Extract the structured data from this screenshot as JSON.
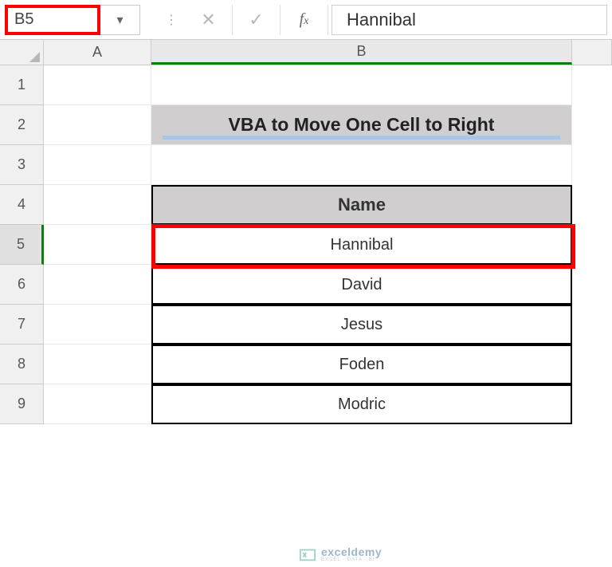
{
  "formula_bar": {
    "name_box": "B5",
    "formula_value": "Hannibal"
  },
  "columns": {
    "a": "A",
    "b": "B"
  },
  "rows": [
    "1",
    "2",
    "3",
    "4",
    "5",
    "6",
    "7",
    "8",
    "9"
  ],
  "sheet": {
    "title": "VBA to Move One Cell to Right",
    "table_header": "Name",
    "names": [
      "Hannibal",
      "David",
      "Jesus",
      "Foden",
      "Modric"
    ]
  },
  "watermark": {
    "brand": "exceldemy",
    "sub": "EXCEL · DATA · BI"
  }
}
